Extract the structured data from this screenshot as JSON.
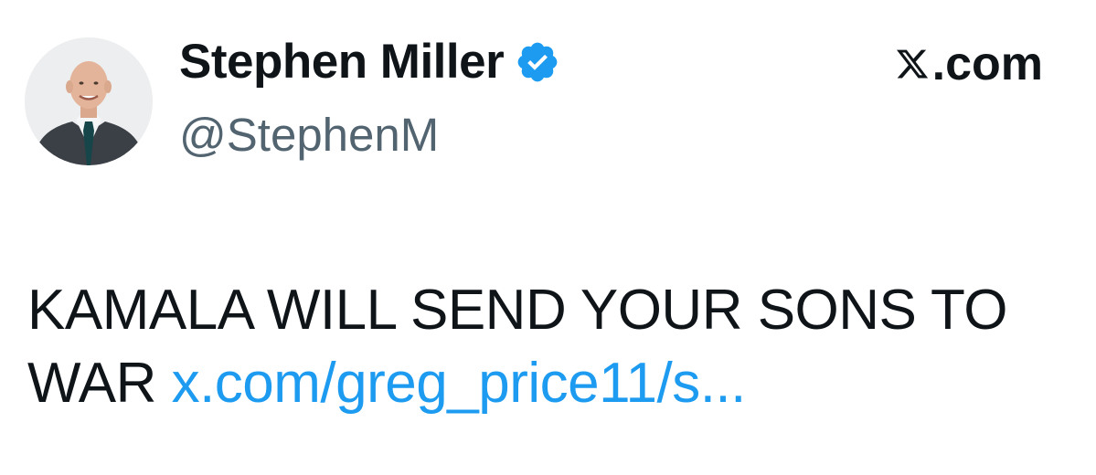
{
  "author": {
    "display_name": "Stephen Miller",
    "handle": "@StephenM",
    "verified": true,
    "verified_color": "#1d9bf0",
    "avatar_icon": "profile-photo"
  },
  "site": {
    "name": ".com",
    "logo_icon": "x-logo-icon"
  },
  "tweet": {
    "text": "KAMALA WILL SEND YOUR SONS TO WAR ",
    "link_text": "x.com/greg_price11/s..."
  },
  "colors": {
    "text": "#0f1419",
    "secondary": "#536471",
    "link": "#1d9bf0"
  }
}
